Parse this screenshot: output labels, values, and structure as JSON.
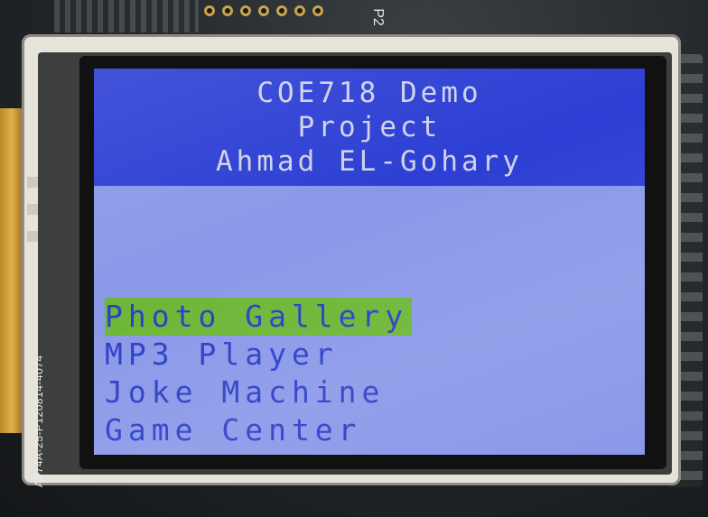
{
  "board": {
    "connector_label": "P2",
    "panel_part_number": "A774A-25-P120814-4074"
  },
  "screen": {
    "title_lines": [
      "COE718 Demo",
      "Project",
      "Ahmad EL-Gohary"
    ],
    "menu": [
      {
        "label": "Photo Gallery",
        "selected": true
      },
      {
        "label": "MP3 Player",
        "selected": false
      },
      {
        "label": "Joke Machine",
        "selected": false
      },
      {
        "label": "Game Center",
        "selected": false
      }
    ],
    "colors": {
      "title_background": "#2d3fd4",
      "screen_background": "#8a98e8",
      "menu_text": "#2a3ec8",
      "selection_highlight": "#6db636"
    }
  }
}
